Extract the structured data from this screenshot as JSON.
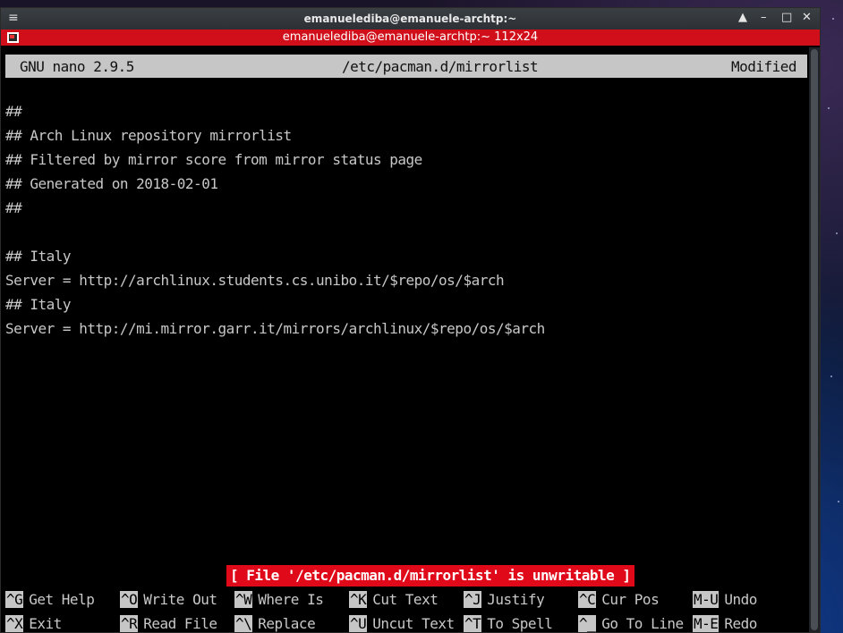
{
  "window": {
    "title": "emanuelediba@emanuele-archtp:~",
    "subtitle": "emanuelediba@emanuele-archtp:~ 112x24",
    "controls": {
      "up": "▲",
      "minimize": "–",
      "maximize": "□",
      "close": "✕"
    },
    "menu_glyph": "≡"
  },
  "nano": {
    "header": {
      "version": "GNU nano 2.9.5",
      "filename": "/etc/pacman.d/mirrorlist",
      "state": "Modified"
    },
    "lines": [
      "##",
      "## Arch Linux repository mirrorlist",
      "## Filtered by mirror score from mirror status page",
      "## Generated on 2018-02-01",
      "##",
      "",
      "## Italy",
      "Server = http://archlinux.students.cs.unibo.it/$repo/os/$arch",
      "## Italy",
      "Server = http://mi.mirror.garr.it/mirrors/archlinux/$repo/os/$arch"
    ],
    "status_message": "[ File '/etc/pacman.d/mirrorlist' is unwritable ]",
    "shortcuts_row1": [
      {
        "key": "^G",
        "label": "Get Help"
      },
      {
        "key": "^O",
        "label": "Write Out"
      },
      {
        "key": "^W",
        "label": "Where Is"
      },
      {
        "key": "^K",
        "label": "Cut Text"
      },
      {
        "key": "^J",
        "label": "Justify"
      },
      {
        "key": "^C",
        "label": "Cur Pos"
      },
      {
        "key": "M-U",
        "label": "Undo"
      }
    ],
    "shortcuts_row2": [
      {
        "key": "^X",
        "label": "Exit"
      },
      {
        "key": "^R",
        "label": "Read File"
      },
      {
        "key": "^\\",
        "label": "Replace"
      },
      {
        "key": "^U",
        "label": "Uncut Text"
      },
      {
        "key": "^T",
        "label": "To Spell"
      },
      {
        "key": "^_",
        "label": "Go To Line"
      },
      {
        "key": "M-E",
        "label": "Redo"
      }
    ]
  },
  "colors": {
    "accent_red": "#d00f1a",
    "header_bg": "#c6c6c6",
    "terminal_bg": "#000000",
    "text": "#c8c8c8"
  }
}
